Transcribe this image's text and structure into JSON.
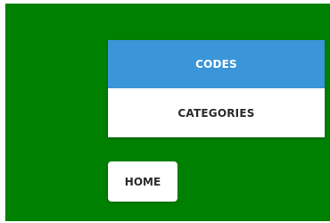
{
  "menu": {
    "items": [
      {
        "label": "CODES",
        "active": true
      },
      {
        "label": "CATEGORIES",
        "active": false
      }
    ]
  },
  "navigation": {
    "home_label": "HOME"
  },
  "colors": {
    "background": "#008000",
    "active_item": "#3b95d9",
    "surface": "#ffffff",
    "text": "#2b2b2b"
  }
}
